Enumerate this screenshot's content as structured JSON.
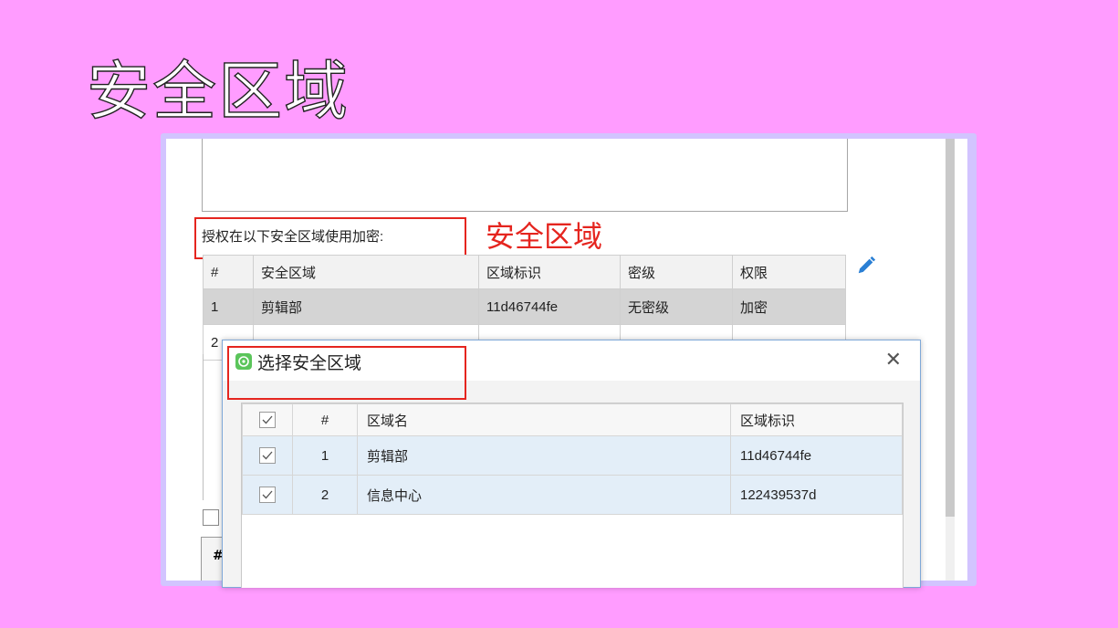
{
  "slide": {
    "title": "安全区域"
  },
  "background_color": "#ff9cff",
  "accent_red": "#e5251f",
  "form": {
    "auth_label": "授权在以下安全区域使用加密:",
    "annotation": "安全区域",
    "edit_icon": "pencil-icon",
    "table": {
      "headers": [
        "#",
        "安全区域",
        "区域标识",
        "密级",
        "权限"
      ],
      "rows": [
        {
          "num": "1",
          "zone": "剪辑部",
          "id": "11d46744fe",
          "level": "无密级",
          "perm": "加密"
        },
        {
          "num": "2",
          "zone": "",
          "id": "",
          "level": "",
          "perm": ""
        }
      ]
    },
    "bottom_header_hash": "#"
  },
  "dialog": {
    "title": "选择安全区域",
    "close_icon": "close-icon",
    "table": {
      "headers": {
        "num": "#",
        "name": "区域名",
        "id": "区域标识"
      },
      "rows": [
        {
          "num": "1",
          "name": "剪辑部",
          "id": "11d46744fe",
          "checked": true
        },
        {
          "num": "2",
          "name": "信息中心",
          "id": "122439537d",
          "checked": true
        }
      ]
    }
  }
}
